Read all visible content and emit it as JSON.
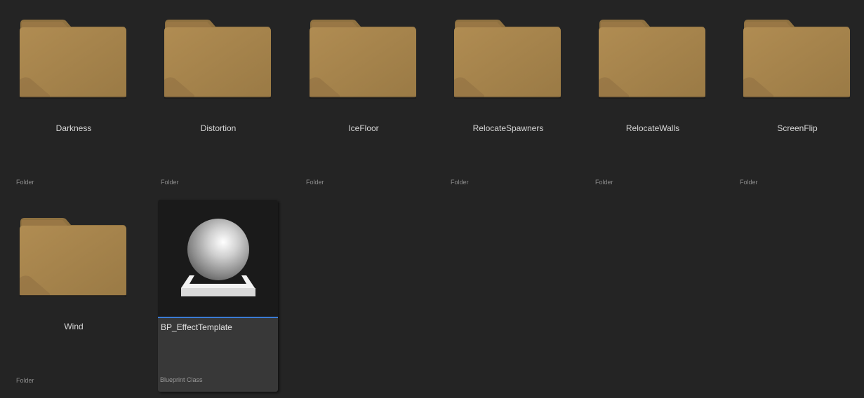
{
  "colors": {
    "background": "#242424",
    "folder_body": "#a8874f",
    "folder_tab": "#8f7140",
    "selection_bar": "#3a7bd5",
    "card_background": "#383838"
  },
  "folders": [
    {
      "name": "Darkness",
      "type": "Folder",
      "icon": "folder-icon"
    },
    {
      "name": "Distortion",
      "type": "Folder",
      "icon": "folder-icon"
    },
    {
      "name": "IceFloor",
      "type": "Folder",
      "icon": "folder-icon"
    },
    {
      "name": "RelocateSpawners",
      "type": "Folder",
      "icon": "folder-icon"
    },
    {
      "name": "RelocateWalls",
      "type": "Folder",
      "icon": "folder-icon"
    },
    {
      "name": "ScreenFlip",
      "type": "Folder",
      "icon": "folder-icon"
    },
    {
      "name": "Wind",
      "type": "Folder",
      "icon": "folder-icon"
    }
  ],
  "asset": {
    "name": "BP_EffectTemplate",
    "type": "Blueprint Class",
    "icon": "blueprint-sphere-icon"
  }
}
